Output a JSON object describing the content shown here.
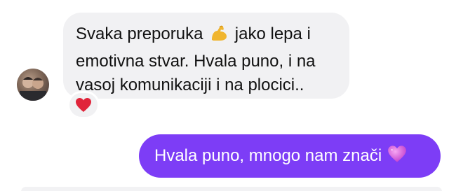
{
  "conversation": {
    "incoming": {
      "lines": [
        "Svaka preporuka",
        "jako lepa i",
        "emotivna stvar. Hvala puno, i na",
        "vasoj komunikaciji i na plocici.."
      ],
      "inline_icon": "flexed-biceps-emoji",
      "reaction": "red-heart-emoji"
    },
    "outgoing": {
      "text": "Hvala puno, mnogo nam znači",
      "icon": "pink-heart-emoji"
    }
  },
  "colors": {
    "incoming_bubble": "#f1f1f3",
    "outgoing_bubble": "#7d3df6",
    "reaction_heart": "#e0243a",
    "pink_heart": "#d04bd9"
  }
}
